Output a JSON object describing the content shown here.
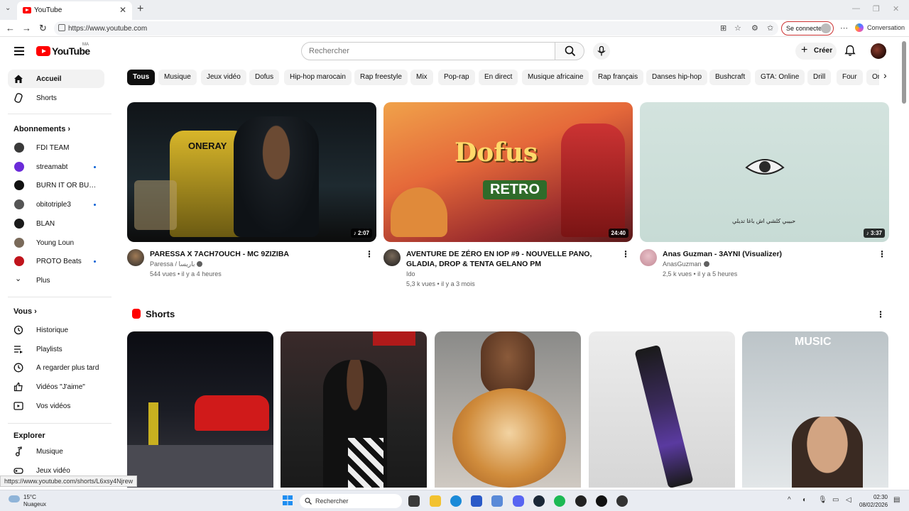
{
  "browser": {
    "tab_title": "YouTube",
    "url": "https://www.youtube.com",
    "signin_label": "Se connecter",
    "conversation_label": "Conversation"
  },
  "header": {
    "logo_text": "YouTube",
    "country_code": "MA",
    "search_placeholder": "Rechercher",
    "create_label": "Créer"
  },
  "sidebar": {
    "main": [
      {
        "label": "Accueil",
        "icon": "home-icon",
        "active": true
      },
      {
        "label": "Shorts",
        "icon": "shorts-icon"
      }
    ],
    "subscriptions_title": "Abonnements",
    "subscriptions": [
      {
        "label": "FDI TEAM",
        "color": "#3a3a3a",
        "dot": false
      },
      {
        "label": "streamabt",
        "color": "#6b2bd9",
        "dot": true
      },
      {
        "label": "BURN IT OR BURN ...",
        "color": "#111111",
        "dot": false
      },
      {
        "label": "obitotriple3",
        "color": "#555555",
        "dot": true
      },
      {
        "label": "BLAN",
        "color": "#1a1a1a",
        "dot": false
      },
      {
        "label": "Young Loun",
        "color": "#7a6a5a",
        "dot": false
      },
      {
        "label": "PROTO Beats",
        "color": "#c0141c",
        "dot": true
      }
    ],
    "more_label": "Plus",
    "you_title": "Vous",
    "you_items": [
      {
        "label": "Historique",
        "icon": "history-icon"
      },
      {
        "label": "Playlists",
        "icon": "playlists-icon"
      },
      {
        "label": "À regarder plus tard",
        "icon": "watch-later-icon"
      },
      {
        "label": "Vidéos \"J'aime\"",
        "icon": "like-icon"
      },
      {
        "label": "Vos vidéos",
        "icon": "your-videos-icon"
      }
    ],
    "explore_title": "Explorer",
    "explore_items": [
      {
        "label": "Musique",
        "icon": "music-icon"
      },
      {
        "label": "Jeux vidéo",
        "icon": "gaming-icon"
      }
    ]
  },
  "chips": [
    "Tous",
    "Musique",
    "Jeux vidéo",
    "Dofus",
    "Hip-hop marocain",
    "Rap freestyle",
    "Mix",
    "Pop-rap",
    "En direct",
    "Musique africaine",
    "Rap français",
    "Danses hip-hop",
    "Bushcraft",
    "GTA: Online",
    "Drill",
    "Four",
    "On"
  ],
  "videos": [
    {
      "title": "PARESSA X 7ACH7OUCH - MC 9ZIZIBA",
      "channel": "Paressa / باريسا",
      "stats": "544 vues • il y a 4 heures",
      "duration": "2:07",
      "music": true
    },
    {
      "title": "AVENTURE DE ZÉRO EN IOP #9 - NOUVELLE PANO, GLADIA, DROP & TENTA GELANO PM",
      "channel": "Ido",
      "stats": "5,3 k vues • il y a 3 mois",
      "duration": "24:40",
      "music": false
    },
    {
      "title": "Anas Guzman - 3AYNI (Visualizer)",
      "channel": "AnasGuzman",
      "stats": "2,5 k vues • il y a 5 heures",
      "duration": "3:37",
      "music": true
    }
  ],
  "thumb_text": {
    "oneray": "ONERAY",
    "dofus": "Dofus",
    "retro": "RETRO",
    "arabic": "حبيبي كلشي اش باغا تديلي"
  },
  "shorts_title": "Shorts",
  "short_overlay": "MUSIC",
  "status_url": "https://www.youtube.com/shorts/L6xsy4Njrew",
  "taskbar": {
    "temperature": "15°C",
    "weather": "Nuageux",
    "search": "Rechercher",
    "time": "02:30",
    "date": "08/02/2026"
  }
}
